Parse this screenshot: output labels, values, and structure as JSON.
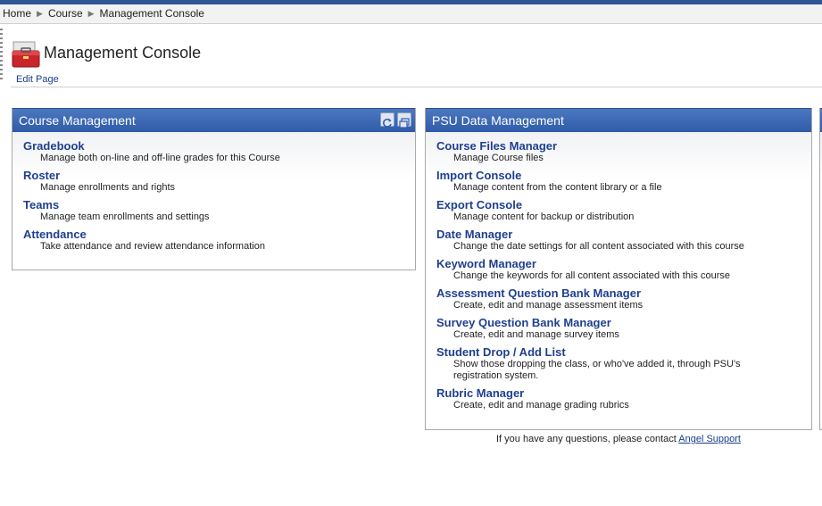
{
  "breadcrumb": [
    "Home",
    "Course",
    "Management Console"
  ],
  "page": {
    "title": "Management Console",
    "edit_link": "Edit Page"
  },
  "panels": {
    "course_management": {
      "title": "Course Management",
      "items": [
        {
          "title": "Gradebook",
          "desc": "Manage both on-line and off-line grades for this Course"
        },
        {
          "title": "Roster",
          "desc": "Manage enrollments and rights"
        },
        {
          "title": "Teams",
          "desc": "Manage team enrollments and settings"
        },
        {
          "title": "Attendance",
          "desc": "Take attendance and review attendance information"
        }
      ]
    },
    "psu_data_management": {
      "title": "PSU Data Management",
      "items": [
        {
          "title": "Course Files Manager",
          "desc": "Manage Course files"
        },
        {
          "title": "Import Console",
          "desc": "Manage content from the content library or a file"
        },
        {
          "title": "Export Console",
          "desc": "Manage content for backup or distribution"
        },
        {
          "title": "Date Manager",
          "desc": "Change the date settings for all content associated with this course"
        },
        {
          "title": "Keyword Manager",
          "desc": "Change the keywords for all content associated with this course"
        },
        {
          "title": "Assessment Question Bank Manager",
          "desc": "Create, edit and manage assessment items"
        },
        {
          "title": "Survey Question Bank Manager",
          "desc": "Create, edit and manage survey items"
        },
        {
          "title": "Student Drop / Add List",
          "desc": "Show those dropping the class, or who've added it, through PSU's registration system."
        },
        {
          "title": "Rubric Manager",
          "desc": "Create, edit and manage grading rubrics"
        }
      ]
    }
  },
  "footer": {
    "text": "If you have any questions, please contact",
    "link": "Angel Support"
  },
  "icons": {
    "toolbox": "toolbox-icon",
    "refresh": "refresh-icon",
    "restore": "restore-window-icon"
  },
  "colors": {
    "panel_header": "#3a66b3",
    "link": "#1f3f8f",
    "top_bar": "#2f5597"
  }
}
